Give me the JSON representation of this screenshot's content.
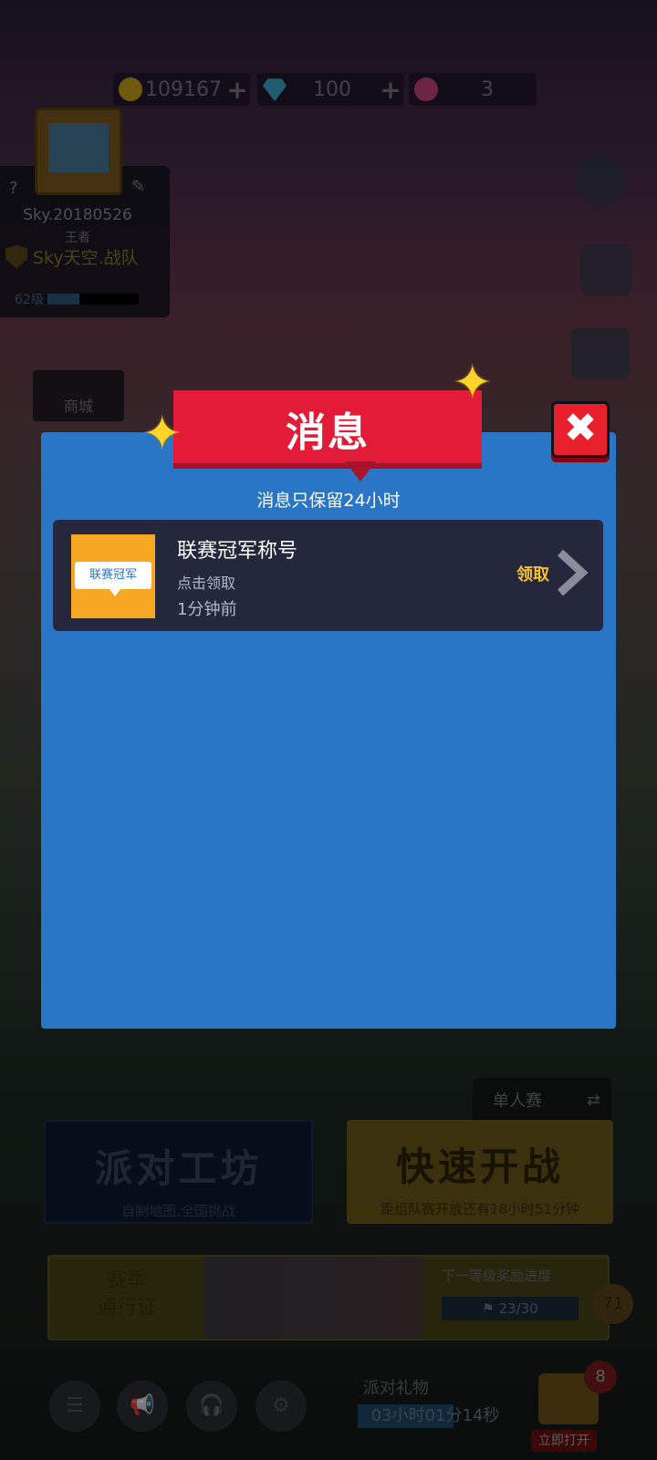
{
  "currency": {
    "coins": "109167",
    "gems": "100",
    "tickets": "3"
  },
  "profile": {
    "name": "Sky.20180526",
    "rank": "王者",
    "team": "Sky天空.战队",
    "level": "62级",
    "level_progress": 0.35,
    "help": "?",
    "edit": "✎"
  },
  "shop_label": "商城",
  "modal": {
    "title": "消息",
    "note": "消息只保留24小时",
    "close": "✖",
    "messages": [
      {
        "thumb_tag": "联赛冠军",
        "title": "联赛冠军称号",
        "subtitle": "点击领取",
        "time": "1分钟前",
        "action": "领取"
      }
    ]
  },
  "mode_label": "单人赛",
  "party_workshop": {
    "title": "派对工坊",
    "subtitle": "自制地图,全国挑战"
  },
  "quick_fight": {
    "title": "快速开战",
    "subtitle": "距组队赛开放还有18小时51分钟"
  },
  "season_pass": {
    "title_line1": "赛季",
    "title_line2": "通行证",
    "next_reward": "下一等级奖励进度",
    "progress": "23/30",
    "level": "71"
  },
  "party_gift": {
    "label": "派对礼物",
    "countdown": "03小时01分14秒",
    "badge": "8",
    "open_label": "立即打开",
    "fill": 0.62
  },
  "colors": {
    "modal_bg": "#2a76c6",
    "ribbon": "#e21c38",
    "claim": "#f4c22a"
  }
}
